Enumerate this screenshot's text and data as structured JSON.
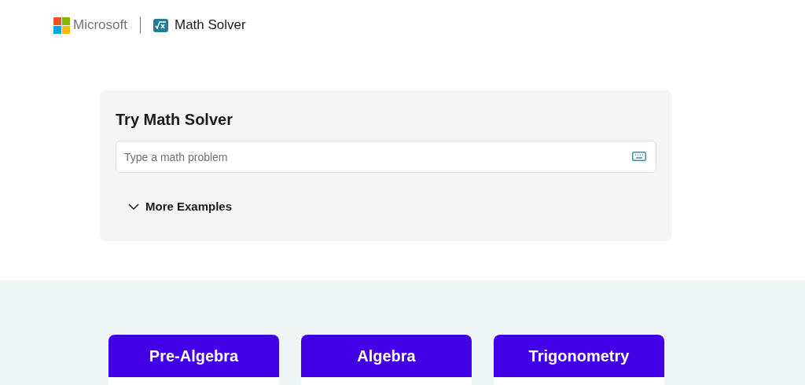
{
  "header": {
    "brand": "Microsoft",
    "product": "Math Solver"
  },
  "solver": {
    "title": "Try Math Solver",
    "input": {
      "placeholder": "Type a math problem"
    },
    "more_examples": {
      "label": "More Examples",
      "expanded": false
    }
  },
  "topics": [
    {
      "label": "Pre-Algebra"
    },
    {
      "label": "Algebra"
    },
    {
      "label": "Trigonometry"
    }
  ]
}
